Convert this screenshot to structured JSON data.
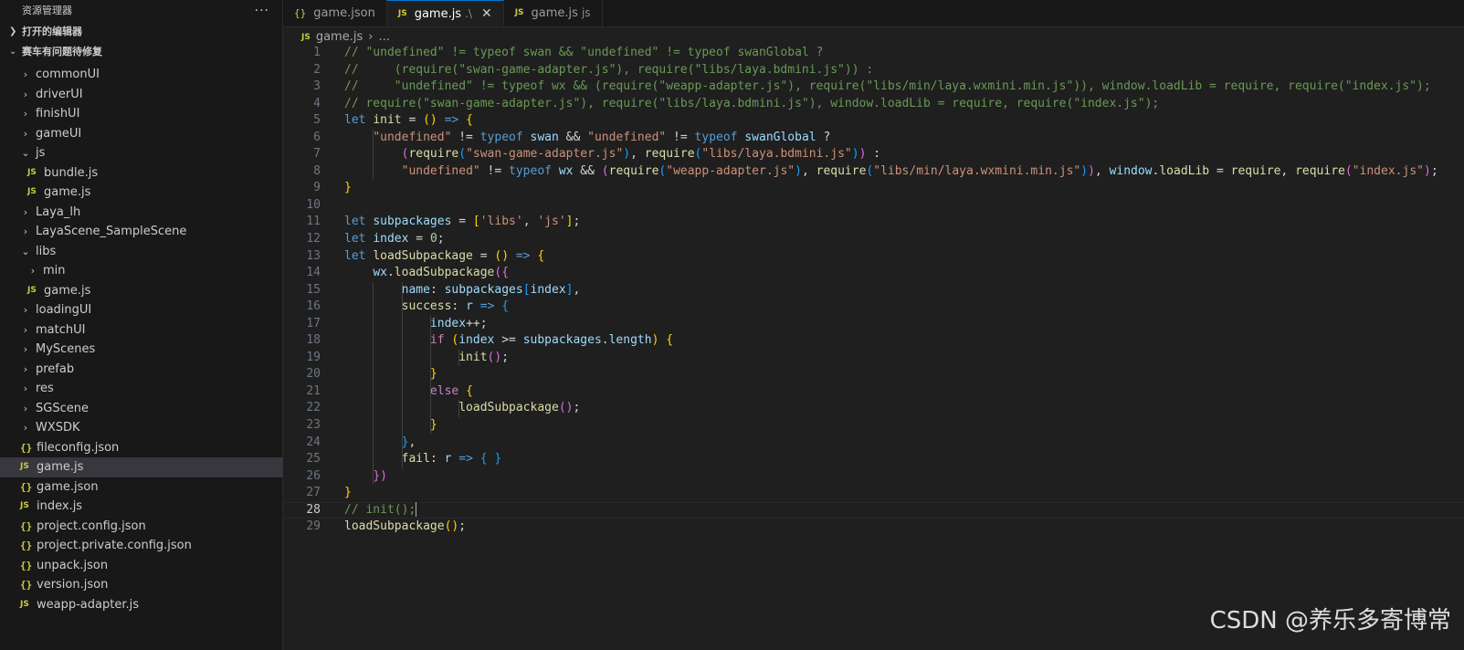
{
  "explorer": {
    "title": "资源管理器",
    "more_label": "···",
    "open_editors_label": "打开的编辑器",
    "project_label": "赛车有问题待修复"
  },
  "tree": [
    {
      "label": "commonUI",
      "type": "folder",
      "depth": 1,
      "expanded": false
    },
    {
      "label": "driverUI",
      "type": "folder",
      "depth": 1,
      "expanded": false
    },
    {
      "label": "finishUI",
      "type": "folder",
      "depth": 1,
      "expanded": false
    },
    {
      "label": "gameUI",
      "type": "folder",
      "depth": 1,
      "expanded": false
    },
    {
      "label": "js",
      "type": "folder",
      "depth": 1,
      "expanded": true
    },
    {
      "label": "bundle.js",
      "type": "js",
      "depth": 2
    },
    {
      "label": "game.js",
      "type": "js",
      "depth": 2
    },
    {
      "label": "Laya_lh",
      "type": "folder",
      "depth": 1,
      "expanded": false
    },
    {
      "label": "LayaScene_SampleScene",
      "type": "folder",
      "depth": 1,
      "expanded": false
    },
    {
      "label": "libs",
      "type": "folder",
      "depth": 1,
      "expanded": true
    },
    {
      "label": "min",
      "type": "folder",
      "depth": 2,
      "expanded": false
    },
    {
      "label": "game.js",
      "type": "js",
      "depth": 2
    },
    {
      "label": "loadingUI",
      "type": "folder",
      "depth": 1,
      "expanded": false
    },
    {
      "label": "matchUI",
      "type": "folder",
      "depth": 1,
      "expanded": false
    },
    {
      "label": "MyScenes",
      "type": "folder",
      "depth": 1,
      "expanded": false
    },
    {
      "label": "prefab",
      "type": "folder",
      "depth": 1,
      "expanded": false
    },
    {
      "label": "res",
      "type": "folder",
      "depth": 1,
      "expanded": false
    },
    {
      "label": "SGScene",
      "type": "folder",
      "depth": 1,
      "expanded": false
    },
    {
      "label": "WXSDK",
      "type": "folder",
      "depth": 1,
      "expanded": false
    },
    {
      "label": "fileconfig.json",
      "type": "json",
      "depth": 1
    },
    {
      "label": "game.js",
      "type": "js",
      "depth": 1,
      "selected": true
    },
    {
      "label": "game.json",
      "type": "json",
      "depth": 1
    },
    {
      "label": "index.js",
      "type": "js",
      "depth": 1
    },
    {
      "label": "project.config.json",
      "type": "json",
      "depth": 1
    },
    {
      "label": "project.private.config.json",
      "type": "json",
      "depth": 1
    },
    {
      "label": "unpack.json",
      "type": "json",
      "depth": 1
    },
    {
      "label": "version.json",
      "type": "json",
      "depth": 1
    },
    {
      "label": "weapp-adapter.js",
      "type": "js",
      "depth": 1
    }
  ],
  "tabs": [
    {
      "label": "game.json",
      "type": "json",
      "active": false,
      "desc": ""
    },
    {
      "label": "game.js",
      "type": "js",
      "active": true,
      "desc": ".\\",
      "close": "✕"
    },
    {
      "label": "game.js",
      "type": "js",
      "active": false,
      "desc": "js"
    }
  ],
  "breadcrumb": {
    "file": "game.js",
    "sep": "›",
    "more": "..."
  },
  "icons": {
    "js": "JS",
    "json": "{}",
    "chevron_right": "›",
    "chevron_down": "⌄"
  },
  "editor": {
    "current_line": 28,
    "lines": [
      [
        [
          "cm",
          "// \"undefined\" != typeof swan && \"undefined\" != typeof swanGlobal ?"
        ]
      ],
      [
        [
          "cm",
          "//     (require(\"swan-game-adapter.js\"), require(\"libs/laya.bdmini.js\")) :"
        ]
      ],
      [
        [
          "cm",
          "//     \"undefined\" != typeof wx && (require(\"weapp-adapter.js\"), require(\"libs/min/laya.wxmini.min.js\")), window.loadLib = require, require(\"index.js\");"
        ]
      ],
      [
        [
          "cm",
          "// require(\"swan-game-adapter.js\"), require(\"libs/laya.bdmini.js\"), window.loadLib = require, require(\"index.js\");"
        ]
      ],
      [
        [
          "kw",
          "let "
        ],
        [
          "fn",
          "init"
        ],
        [
          "pun",
          " = "
        ],
        [
          "br",
          "()"
        ],
        [
          "pun",
          " "
        ],
        [
          "kw",
          "=>"
        ],
        [
          "pun",
          " "
        ],
        [
          "br",
          "{"
        ]
      ],
      [
        [
          "pun",
          "    "
        ],
        [
          "str",
          "\"undefined\""
        ],
        [
          "pun",
          " != "
        ],
        [
          "kw",
          "typeof"
        ],
        [
          "pun",
          " "
        ],
        [
          "id",
          "swan"
        ],
        [
          "pun",
          " && "
        ],
        [
          "str",
          "\"undefined\""
        ],
        [
          "pun",
          " != "
        ],
        [
          "kw",
          "typeof"
        ],
        [
          "pun",
          " "
        ],
        [
          "id",
          "swanGlobal"
        ],
        [
          "pun",
          " ?"
        ]
      ],
      [
        [
          "pun",
          "        "
        ],
        [
          "br2",
          "("
        ],
        [
          "fn",
          "require"
        ],
        [
          "br3",
          "("
        ],
        [
          "str",
          "\"swan-game-adapter.js\""
        ],
        [
          "br3",
          ")"
        ],
        [
          "pun",
          ", "
        ],
        [
          "fn",
          "require"
        ],
        [
          "br3",
          "("
        ],
        [
          "str",
          "\"libs/laya.bdmini.js\""
        ],
        [
          "br3",
          ")"
        ],
        [
          "br2",
          ")"
        ],
        [
          "pun",
          " :"
        ]
      ],
      [
        [
          "pun",
          "        "
        ],
        [
          "str",
          "\"undefined\""
        ],
        [
          "pun",
          " != "
        ],
        [
          "kw",
          "typeof"
        ],
        [
          "pun",
          " "
        ],
        [
          "id",
          "wx"
        ],
        [
          "pun",
          " && "
        ],
        [
          "br2",
          "("
        ],
        [
          "fn",
          "require"
        ],
        [
          "br3",
          "("
        ],
        [
          "str",
          "\"weapp-adapter.js\""
        ],
        [
          "br3",
          ")"
        ],
        [
          "pun",
          ", "
        ],
        [
          "fn",
          "require"
        ],
        [
          "br3",
          "("
        ],
        [
          "str",
          "\"libs/min/laya.wxmini.min.js\""
        ],
        [
          "br3",
          ")"
        ],
        [
          "br2",
          ")"
        ],
        [
          "pun",
          ", "
        ],
        [
          "id",
          "window"
        ],
        [
          "pun",
          "."
        ],
        [
          "fn",
          "loadLib"
        ],
        [
          "pun",
          " = "
        ],
        [
          "fn",
          "require"
        ],
        [
          "pun",
          ", "
        ],
        [
          "fn",
          "require"
        ],
        [
          "br2",
          "("
        ],
        [
          "str",
          "\"index.js\""
        ],
        [
          "br2",
          ")"
        ],
        [
          "pun",
          ";"
        ]
      ],
      [
        [
          "br",
          "}"
        ]
      ],
      [],
      [
        [
          "kw",
          "let "
        ],
        [
          "id",
          "subpackages"
        ],
        [
          "pun",
          " = "
        ],
        [
          "br",
          "["
        ],
        [
          "str",
          "'libs'"
        ],
        [
          "pun",
          ", "
        ],
        [
          "str",
          "'js'"
        ],
        [
          "br",
          "]"
        ],
        [
          "pun",
          ";"
        ]
      ],
      [
        [
          "kw",
          "let "
        ],
        [
          "id",
          "index"
        ],
        [
          "pun",
          " = "
        ],
        [
          "num",
          "0"
        ],
        [
          "pun",
          ";"
        ]
      ],
      [
        [
          "kw",
          "let "
        ],
        [
          "fn",
          "loadSubpackage"
        ],
        [
          "pun",
          " = "
        ],
        [
          "br",
          "()"
        ],
        [
          "pun",
          " "
        ],
        [
          "kw",
          "=>"
        ],
        [
          "pun",
          " "
        ],
        [
          "br",
          "{"
        ]
      ],
      [
        [
          "pun",
          "    "
        ],
        [
          "id",
          "wx"
        ],
        [
          "pun",
          "."
        ],
        [
          "fn",
          "loadSubpackage"
        ],
        [
          "br2",
          "({"
        ]
      ],
      [
        [
          "pun",
          "        "
        ],
        [
          "id",
          "name"
        ],
        [
          "pun",
          ": "
        ],
        [
          "id",
          "subpackages"
        ],
        [
          "br3",
          "["
        ],
        [
          "id",
          "index"
        ],
        [
          "br3",
          "]"
        ],
        [
          "pun",
          ","
        ]
      ],
      [
        [
          "pun",
          "        "
        ],
        [
          "fn",
          "success"
        ],
        [
          "pun",
          ": "
        ],
        [
          "id",
          "r"
        ],
        [
          "pun",
          " "
        ],
        [
          "kw",
          "=>"
        ],
        [
          "pun",
          " "
        ],
        [
          "br3",
          "{"
        ]
      ],
      [
        [
          "pun",
          "            "
        ],
        [
          "id",
          "index"
        ],
        [
          "pun",
          "++;"
        ]
      ],
      [
        [
          "pun",
          "            "
        ],
        [
          "ctl",
          "if"
        ],
        [
          "pun",
          " "
        ],
        [
          "br",
          "("
        ],
        [
          "id",
          "index"
        ],
        [
          "pun",
          " >= "
        ],
        [
          "id",
          "subpackages"
        ],
        [
          "pun",
          "."
        ],
        [
          "id",
          "length"
        ],
        [
          "br",
          ")"
        ],
        [
          "pun",
          " "
        ],
        [
          "br",
          "{"
        ]
      ],
      [
        [
          "pun",
          "                "
        ],
        [
          "fn",
          "init"
        ],
        [
          "br2",
          "()"
        ],
        [
          "pun",
          ";"
        ]
      ],
      [
        [
          "pun",
          "            "
        ],
        [
          "br",
          "}"
        ]
      ],
      [
        [
          "pun",
          "            "
        ],
        [
          "ctl",
          "else"
        ],
        [
          "pun",
          " "
        ],
        [
          "br",
          "{"
        ]
      ],
      [
        [
          "pun",
          "                "
        ],
        [
          "fn",
          "loadSubpackage"
        ],
        [
          "br2",
          "()"
        ],
        [
          "pun",
          ";"
        ]
      ],
      [
        [
          "pun",
          "            "
        ],
        [
          "br",
          "}"
        ]
      ],
      [
        [
          "pun",
          "        "
        ],
        [
          "br3",
          "}"
        ],
        [
          "pun",
          ","
        ]
      ],
      [
        [
          "pun",
          "        "
        ],
        [
          "fn",
          "fail"
        ],
        [
          "pun",
          ": "
        ],
        [
          "id",
          "r"
        ],
        [
          "pun",
          " "
        ],
        [
          "kw",
          "=>"
        ],
        [
          "pun",
          " "
        ],
        [
          "br3",
          "{"
        ],
        [
          "pun",
          " "
        ],
        [
          "br3",
          "}"
        ]
      ],
      [
        [
          "pun",
          "    "
        ],
        [
          "br2",
          "})"
        ]
      ],
      [
        [
          "br",
          "}"
        ]
      ],
      [
        [
          "cm",
          "// init();"
        ],
        [
          "caret",
          ""
        ]
      ],
      [
        [
          "fn",
          "loadSubpackage"
        ],
        [
          "br",
          "()"
        ],
        [
          "pun",
          ";"
        ]
      ]
    ]
  },
  "watermark": "CSDN @养乐多寄博常"
}
